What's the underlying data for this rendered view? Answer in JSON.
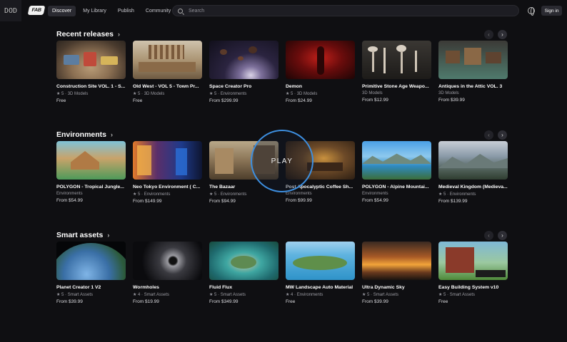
{
  "corner_logo": "DOD",
  "brand": "FAB",
  "nav": [
    "Discover",
    "My Library",
    "Publish",
    "Community"
  ],
  "search": {
    "placeholder": "Search"
  },
  "signin": "Sign in",
  "play": "PLAY",
  "sections": [
    {
      "title": "Recent releases",
      "cards": [
        {
          "title": "Construction Site VOL. 1 - S...",
          "meta": "★ 5 · 3D Models",
          "price": "Free"
        },
        {
          "title": "Old West - VOL 5 - Town Pr...",
          "meta": "★ 5 · 3D Models",
          "price": "Free"
        },
        {
          "title": "Space Creator Pro",
          "meta": "★ 5 · Environments",
          "price": "From $299.99"
        },
        {
          "title": "Demon",
          "meta": "★ 5 · 3D Models",
          "price": "From $24.99"
        },
        {
          "title": "Primitive Stone Age Weapo...",
          "meta": "3D Models",
          "price": "From $12.99"
        },
        {
          "title": "Antiques in the Attic VOL. 3",
          "meta": "3D Models",
          "price": "From $39.99"
        }
      ]
    },
    {
      "title": "Environments",
      "cards": [
        {
          "title": "POLYGON - Tropical Jungle...",
          "meta": "Environments",
          "price": "From $54.99"
        },
        {
          "title": "Neo Tokyo Environment ( C...",
          "meta": "★ 5 · Environments",
          "price": "From $149.99"
        },
        {
          "title": "The Bazaar",
          "meta": "★ 5 · Environments",
          "price": "From $94.99"
        },
        {
          "title": "Post Apocalyptic Coffee Sh...",
          "meta": "Environments",
          "price": "From $99.99"
        },
        {
          "title": "POLYGON - Alpine Mountai...",
          "meta": "Environments",
          "price": "From $54.99"
        },
        {
          "title": "Medieval Kingdom (Medieva...",
          "meta": "★ 5 · Environments",
          "price": "From $139.99"
        }
      ]
    },
    {
      "title": "Smart assets",
      "cards": [
        {
          "title": "Planet Creator 1 V2",
          "meta": "★ 5 · Smart Assets",
          "price": "From $39.99"
        },
        {
          "title": "Wormholes",
          "meta": "★ 4 · Smart Assets",
          "price": "From $19.99"
        },
        {
          "title": "Fluid Flux",
          "meta": "★ 5 · Smart Assets",
          "price": "From $349.99"
        },
        {
          "title": "MW Landscape Auto Material",
          "meta": "★ 4 · Environments",
          "price": "Free"
        },
        {
          "title": "Ultra Dynamic Sky",
          "meta": "★ 5 · Smart Assets",
          "price": "From $39.99"
        },
        {
          "title": "Easy Building System v10",
          "meta": "★ 5 · Smart Assets",
          "price": "Free"
        }
      ]
    }
  ]
}
